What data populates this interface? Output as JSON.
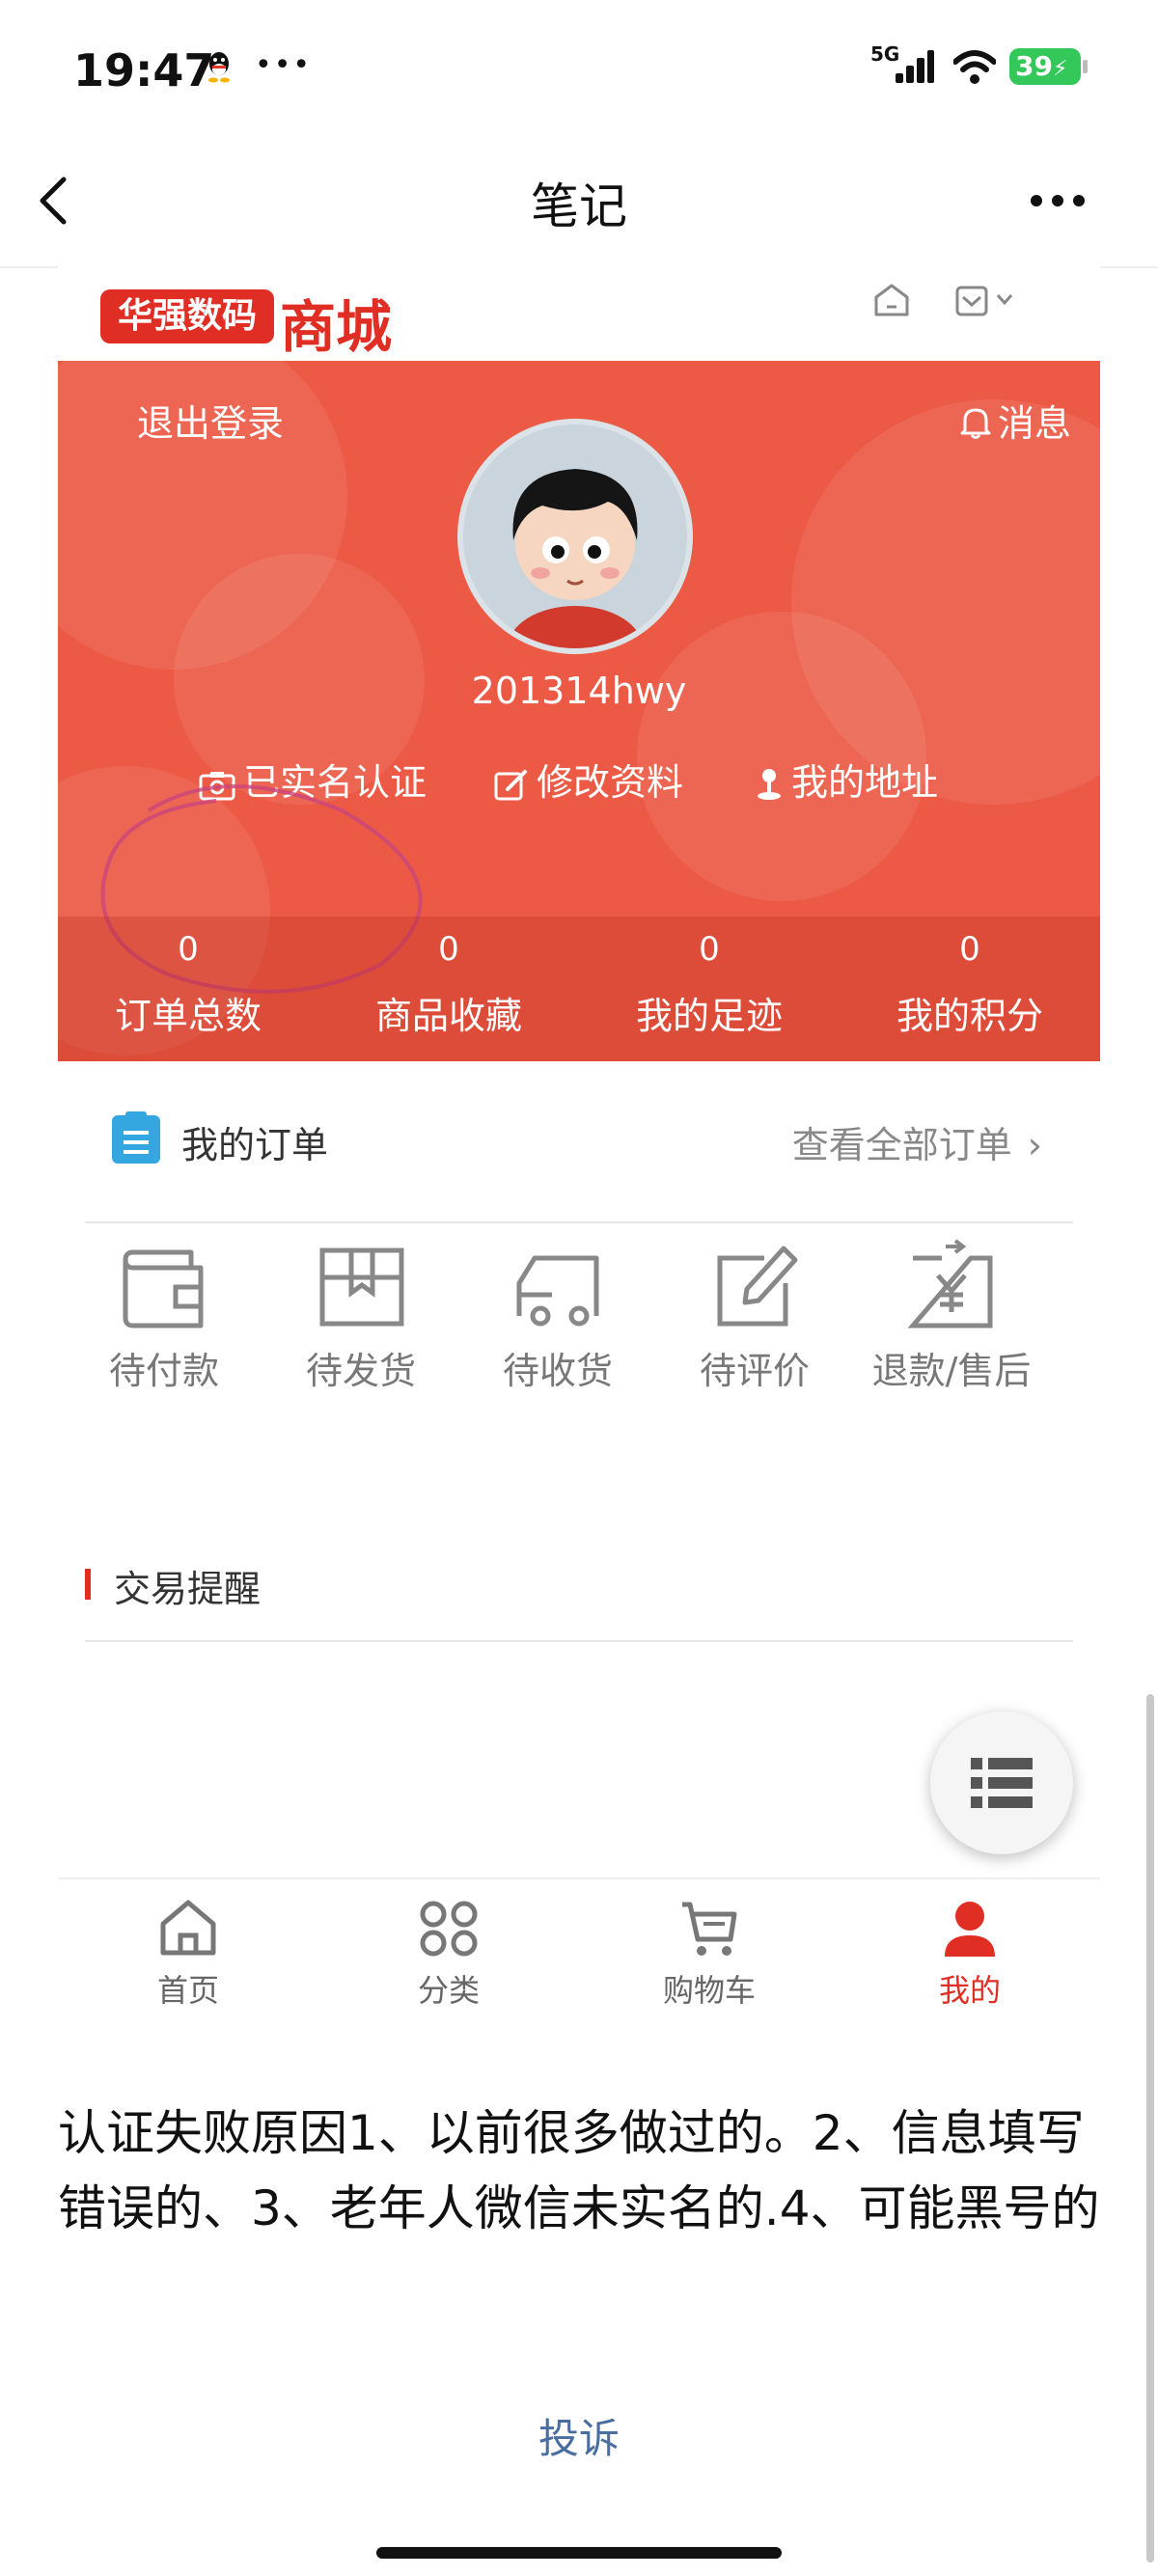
{
  "status_bar": {
    "time": "19:47",
    "network": "5G",
    "battery": "39"
  },
  "nav": {
    "title": "笔记"
  },
  "shop": {
    "brand_box": "华强数码",
    "brand_text": "商城",
    "logout": "退出登录",
    "messages": "消息",
    "username": "201314hwy",
    "links": {
      "verified": "已实名认证",
      "edit": "修改资料",
      "address": "我的地址"
    },
    "stats": [
      {
        "value": "0",
        "label": "订单总数"
      },
      {
        "value": "0",
        "label": "商品收藏"
      },
      {
        "value": "0",
        "label": "我的足迹"
      },
      {
        "value": "0",
        "label": "我的积分"
      }
    ],
    "orders": {
      "title": "我的订单",
      "view_all": "查看全部订单"
    },
    "order_status": [
      "待付款",
      "待发货",
      "待收货",
      "待评价",
      "退款/售后"
    ],
    "trade_reminder": "交易提醒",
    "tabs": [
      {
        "label": "首页",
        "icon": "home-icon"
      },
      {
        "label": "分类",
        "icon": "grid-icon"
      },
      {
        "label": "购物车",
        "icon": "cart-icon"
      },
      {
        "label": "我的",
        "icon": "user-icon",
        "active": true
      }
    ],
    "accent_color": "#e02e24"
  },
  "note": {
    "text": "认证失败原因1、以前很多做过的。2、信息填写错误的、3、老年人微信未实名的.4、可能黑号的",
    "complain": "投诉"
  }
}
